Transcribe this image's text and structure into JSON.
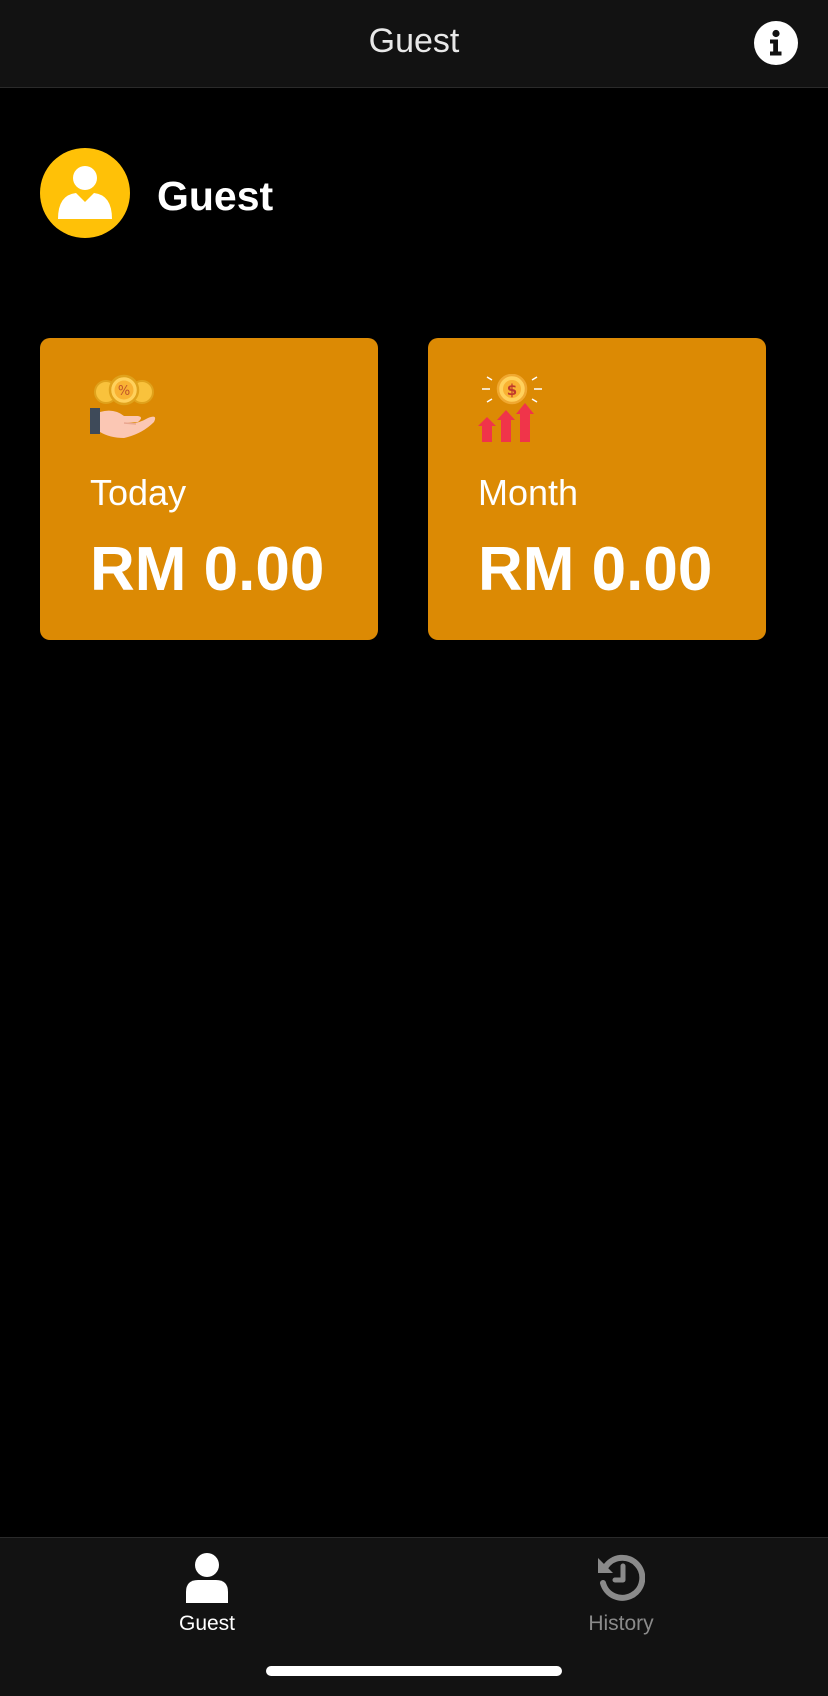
{
  "header": {
    "title": "Guest"
  },
  "profile": {
    "name": "Guest"
  },
  "cards": [
    {
      "label": "Today",
      "value": "RM 0.00",
      "icon": "coins-hand-icon"
    },
    {
      "label": "Month",
      "value": "RM 0.00",
      "icon": "dollar-growth-icon"
    }
  ],
  "tabs": [
    {
      "label": "Guest",
      "icon": "person-icon",
      "active": true
    },
    {
      "label": "History",
      "icon": "history-icon",
      "active": false
    }
  ],
  "colors": {
    "accent": "#DC8A04",
    "avatar": "#FFC107",
    "background": "#000000",
    "bar": "#121212",
    "inactive_tab": "#8A8A8A"
  }
}
